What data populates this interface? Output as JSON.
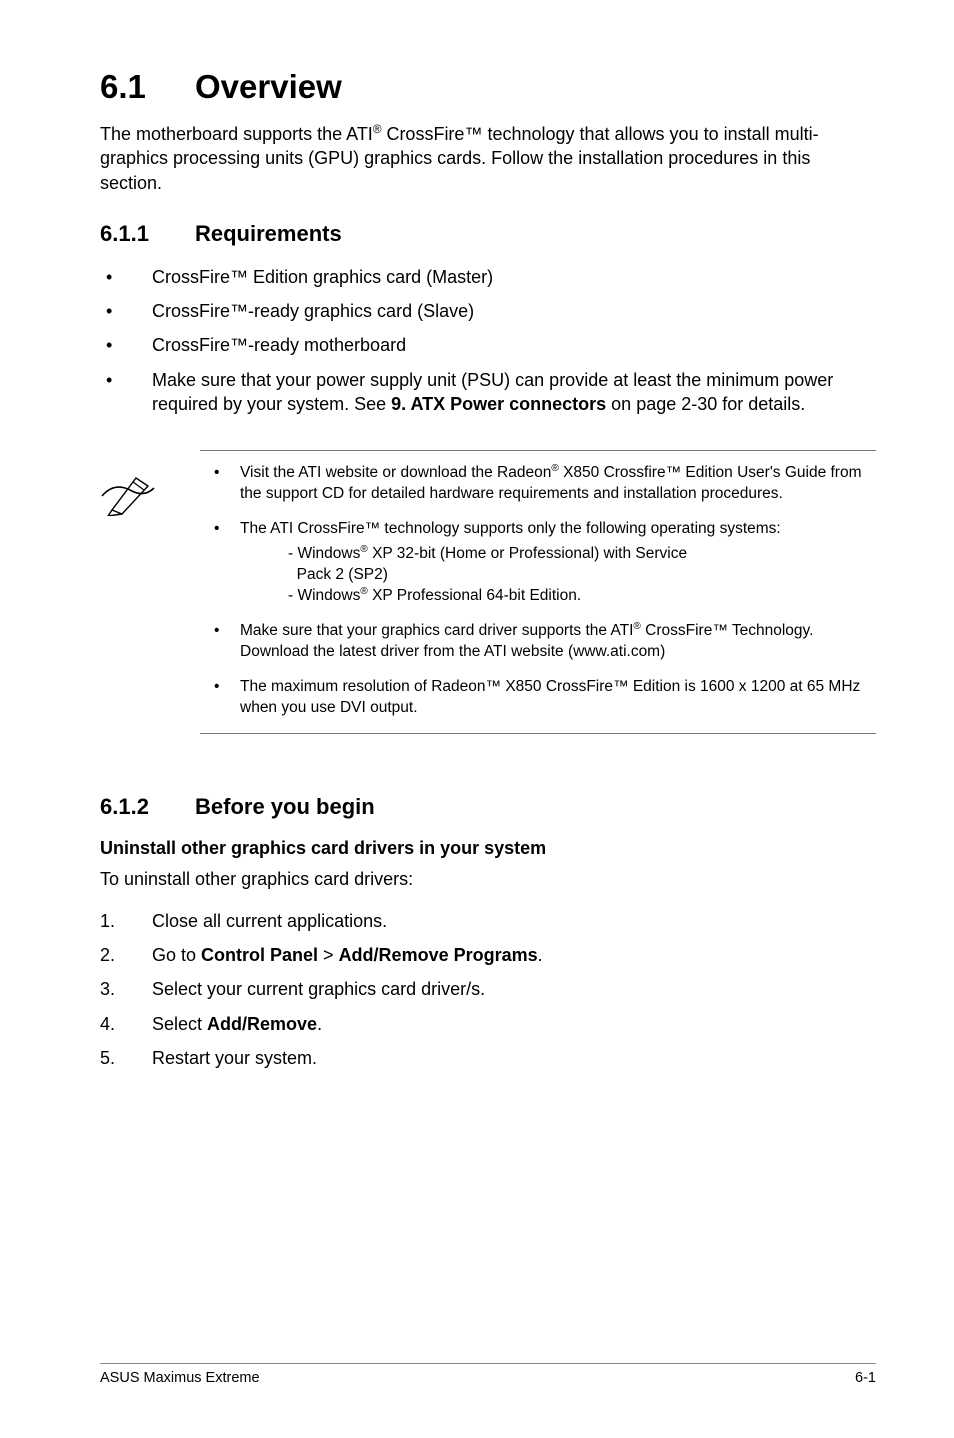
{
  "section": {
    "number": "6.1",
    "title": "Overview",
    "intro_pre": "The motherboard supports the ATI",
    "intro_sup": "®",
    "intro_post": " CrossFire™ technology that allows you to install multi-graphics processing units (GPU) graphics cards. Follow the installation procedures in this section."
  },
  "sub611": {
    "number": "6.1.1",
    "title": "Requirements",
    "items": [
      "CrossFire™ Edition graphics card (Master)",
      "CrossFire™-ready graphics card (Slave)",
      "CrossFire™-ready motherboard"
    ],
    "item4_pre": "Make sure that your power supply unit (PSU) can provide at least the minimum power required by your system. See ",
    "item4_bold": "9. ATX Power connectors",
    "item4_post": " on page 2-30 for details."
  },
  "note": {
    "n1_pre": "Visit the ATI website or download the Radeon",
    "n1_sup": "®",
    "n1_post": " X850 Crossfire™ Edition User's Guide from the support CD for detailed hardware requirements and installation procedures.",
    "n2": "The ATI CrossFire™ technology supports only the following operating systems:",
    "n2_sub1_pre": "- Windows",
    "n2_sub1_sup": "®",
    "n2_sub1_post": " XP 32-bit  (Home or Professional) with Service",
    "n2_sub1_line2": "  Pack 2 (SP2)",
    "n2_sub2_pre": "- Windows",
    "n2_sub2_sup": "®",
    "n2_sub2_post": " XP Professional 64-bit Edition.",
    "n3_pre": "Make sure that your graphics card driver supports the ATI",
    "n3_sup": "®",
    "n3_post": " CrossFire™ Technology. Download the latest driver from the ATI website (www.ati.com)",
    "n4": "The maximum resolution of Radeon™ X850 CrossFire™ Edition is 1600 x 1200 at 65 MHz when you use DVI output."
  },
  "sub612": {
    "number": "6.1.2",
    "title": "Before you begin",
    "h3": "Uninstall other graphics card drivers in your system",
    "p": "To uninstall other graphics card drivers:",
    "steps": {
      "s1": "Close all current applications.",
      "s2_pre": "Go to ",
      "s2_b1": "Control Panel",
      "s2_mid": " > ",
      "s2_b2": "Add/Remove Programs",
      "s2_post": ".",
      "s3": "Select your current graphics card driver/s.",
      "s4_pre": "Select ",
      "s4_b": "Add/Remove",
      "s4_post": ".",
      "s5": "Restart your system."
    }
  },
  "footer": {
    "left": "ASUS Maximus Extreme",
    "right": "6-1"
  }
}
